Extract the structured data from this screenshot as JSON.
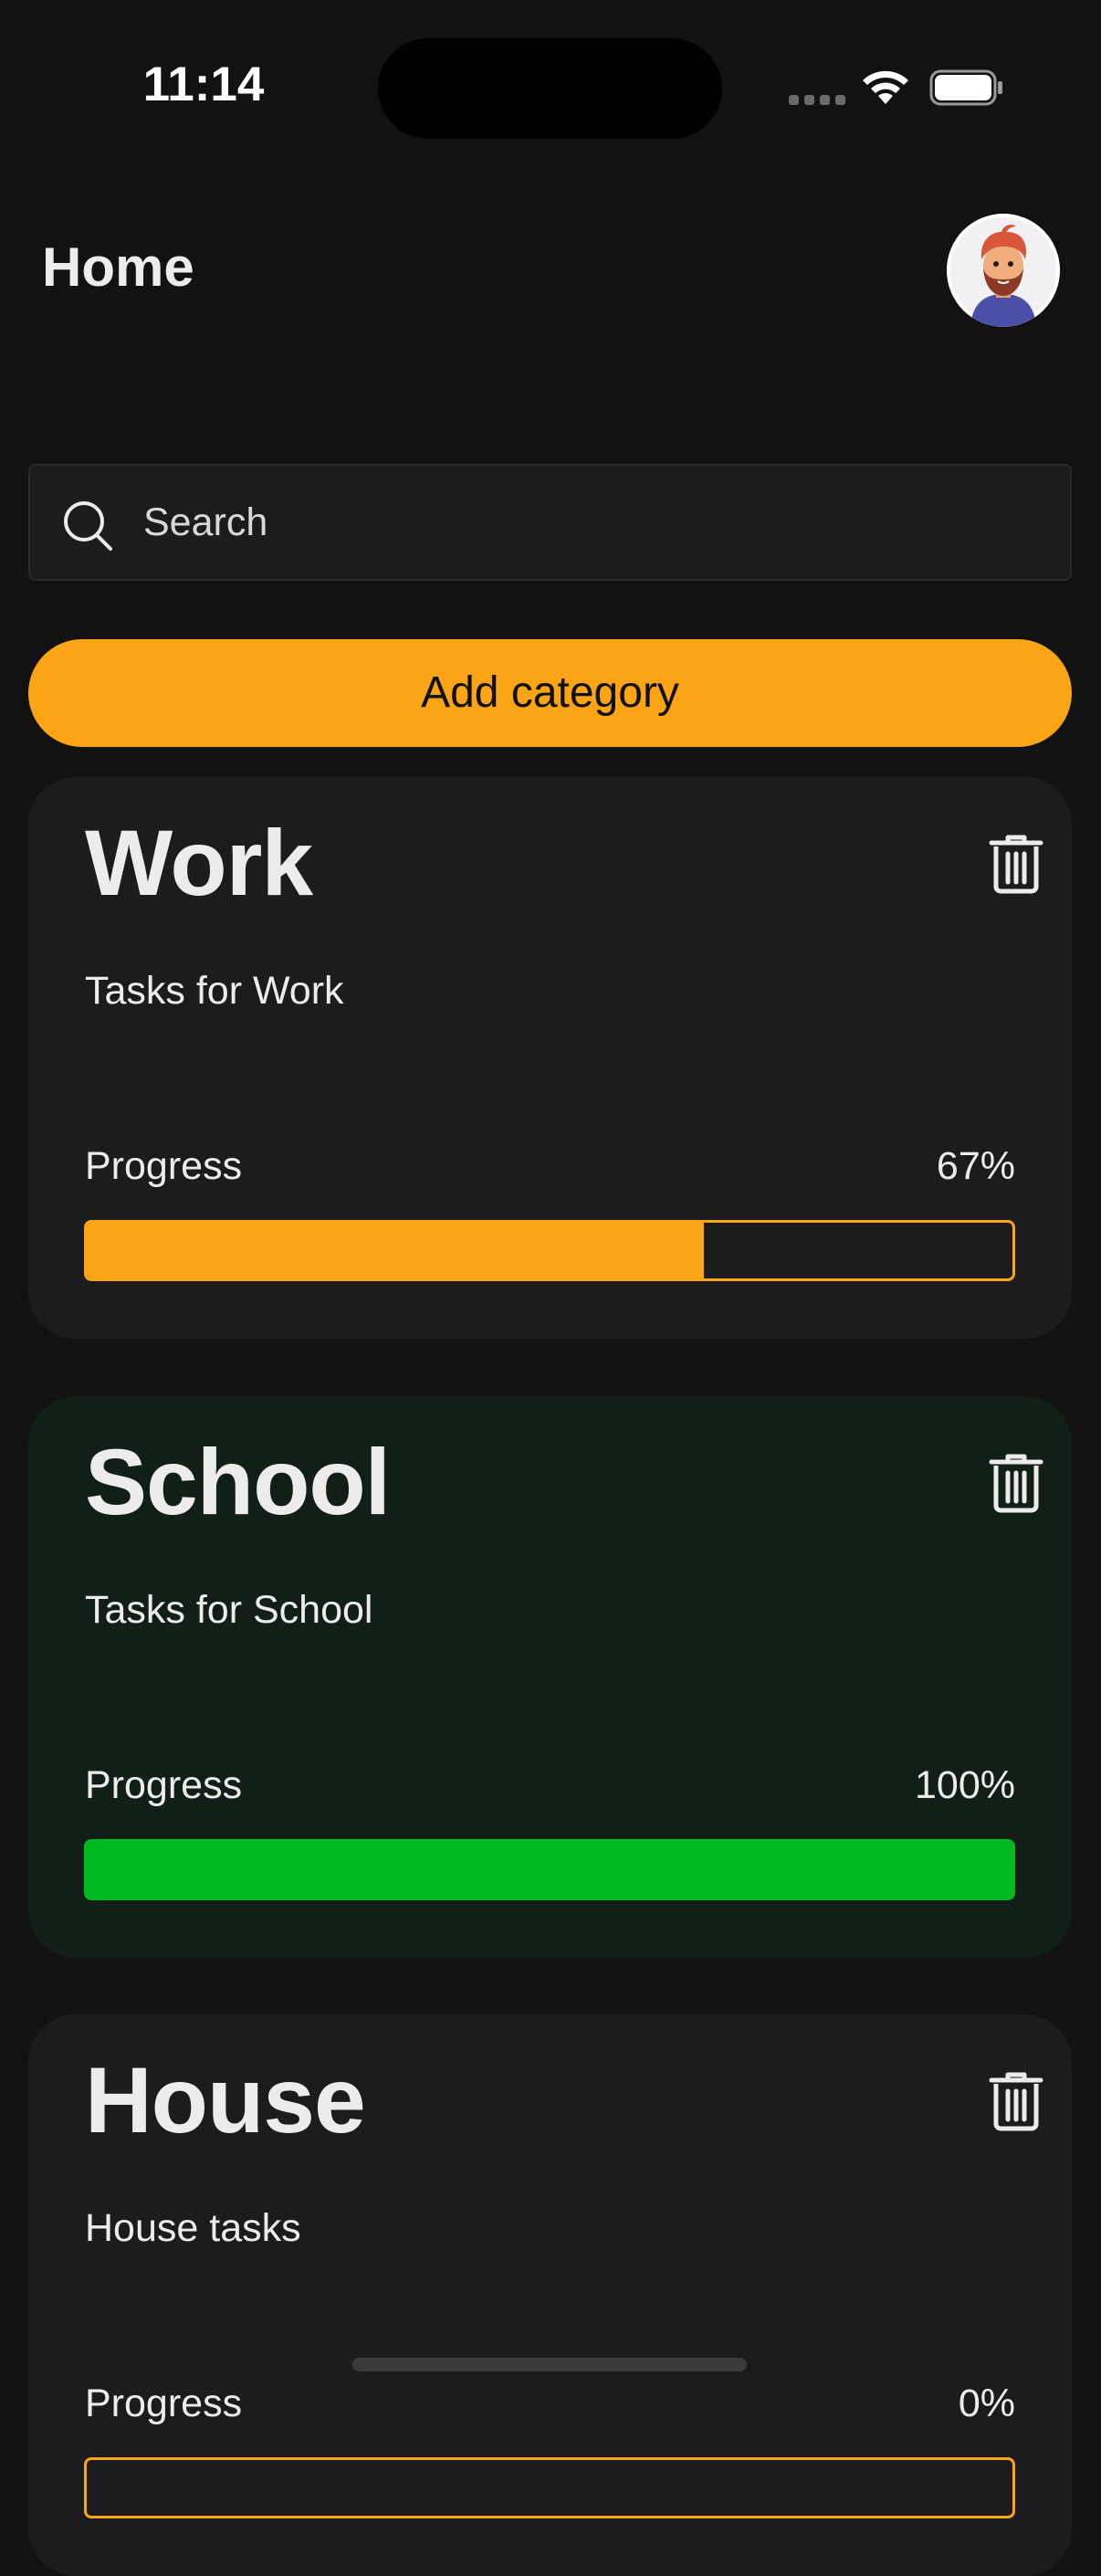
{
  "status_bar": {
    "time": "11:14"
  },
  "header": {
    "title": "Home",
    "avatar_icon": "memoji-avatar-icon"
  },
  "search": {
    "placeholder": "Search",
    "value": ""
  },
  "add_category": {
    "label": "Add category"
  },
  "colors": {
    "accent": "#FBA516",
    "success": "#00B923",
    "background": "#121212",
    "card": "#1C1C1E",
    "card_complete": "#121F17"
  },
  "categories": [
    {
      "title": "Work",
      "description": "Tasks for Work",
      "progress_label": "Progress",
      "progress_text": "67%",
      "progress": 0.667,
      "status": "in-progress"
    },
    {
      "title": "School",
      "description": "Tasks for School",
      "progress_label": "Progress",
      "progress_text": "100%",
      "progress": 1.0,
      "status": "complete"
    },
    {
      "title": "House",
      "description": "House tasks",
      "progress_label": "Progress",
      "progress_text": "0%",
      "progress": 0,
      "status": "in-progress"
    }
  ]
}
